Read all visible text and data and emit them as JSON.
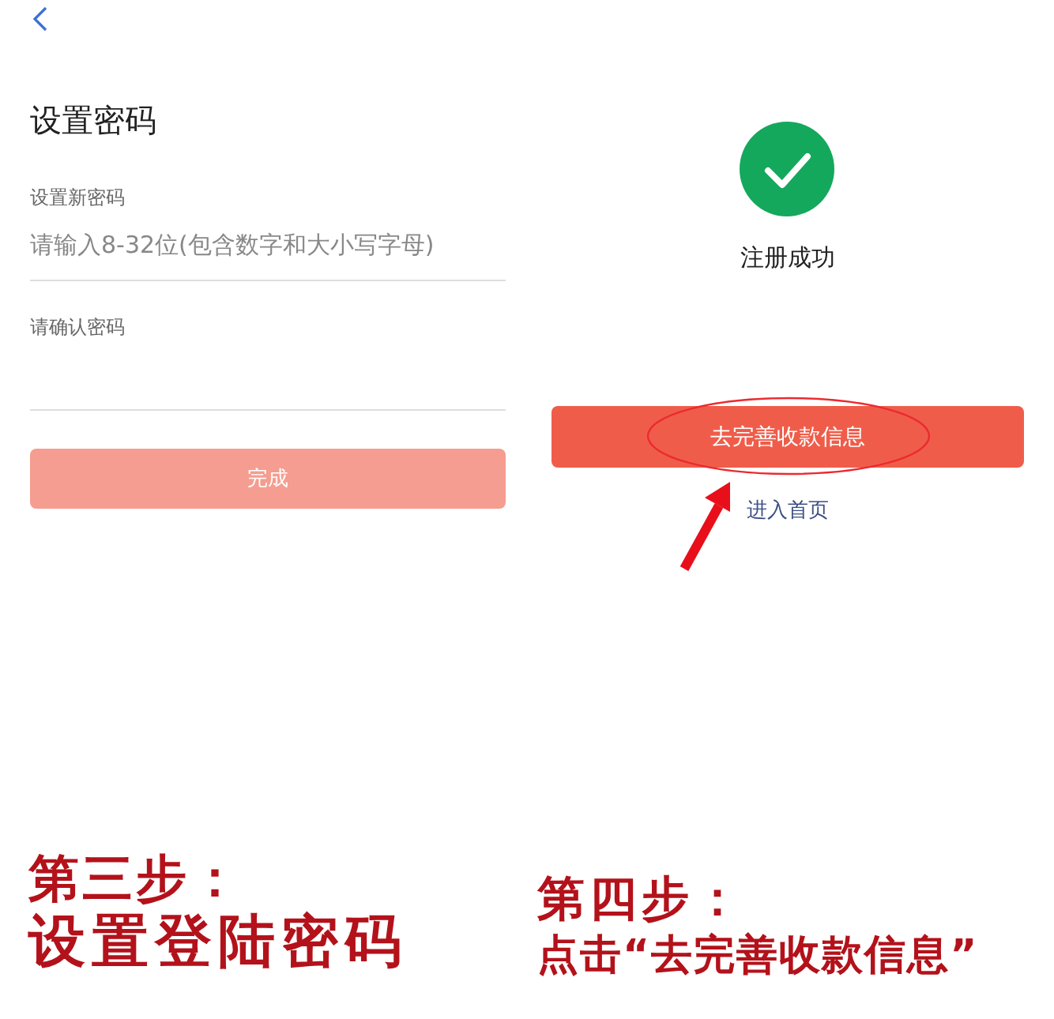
{
  "left_screen": {
    "title": "设置密码",
    "fields": [
      {
        "label": "设置新密码",
        "placeholder": "请输入8-32位(包含数字和大小写字母)"
      },
      {
        "label": "请确认密码"
      }
    ],
    "submit_button": {
      "label": "完成",
      "disabled": true
    }
  },
  "right_screen": {
    "status": "注册成功",
    "primary_button": {
      "label": "去完善收款信息",
      "highlighted": true
    },
    "link": "进入首页"
  },
  "captions": [
    {
      "step": "第三步：",
      "text": "设置登陆密码"
    },
    {
      "step": "第四步：",
      "text": "点击“去完善收款信息”"
    }
  ]
}
